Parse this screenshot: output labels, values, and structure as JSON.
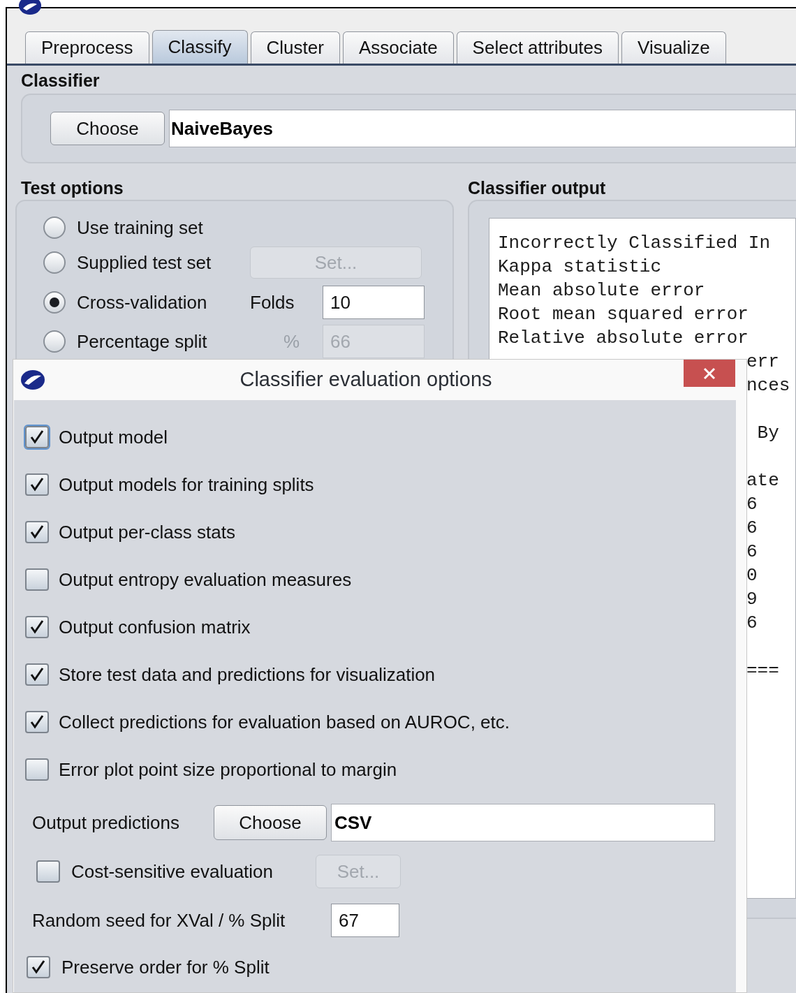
{
  "tabs": [
    {
      "label": "Preprocess",
      "selected": false
    },
    {
      "label": "Classify",
      "selected": true
    },
    {
      "label": "Cluster",
      "selected": false
    },
    {
      "label": "Associate",
      "selected": false
    },
    {
      "label": "Select attributes",
      "selected": false
    },
    {
      "label": "Visualize",
      "selected": false
    }
  ],
  "classifier": {
    "heading": "Classifier",
    "button": "Choose",
    "value": "NaiveBayes"
  },
  "test_options": {
    "heading": "Test options",
    "options": [
      {
        "kind": "plain",
        "label": "Use training set",
        "selected": false
      },
      {
        "kind": "button",
        "label": "Supplied test set",
        "selected": false,
        "button": "Set...",
        "disabled": true
      },
      {
        "kind": "field",
        "label": "Cross-validation",
        "selected": true,
        "field_label": "Folds",
        "value": "10",
        "disabled": false
      },
      {
        "kind": "field",
        "label": "Percentage split",
        "selected": false,
        "field_label": "%",
        "value": "66",
        "disabled": true
      }
    ]
  },
  "classifier_output": {
    "heading": "Classifier output",
    "rows": [
      {
        "kind": "line",
        "text": "Incorrectly Classified In"
      },
      {
        "kind": "line",
        "text": "Kappa statistic"
      },
      {
        "kind": "line",
        "text": "Mean absolute error"
      },
      {
        "kind": "line",
        "text": "Root mean squared error"
      },
      {
        "kind": "line",
        "text": "Relative absolute error"
      },
      {
        "kind": "tail",
        "text": "err"
      },
      {
        "kind": "tail",
        "text": "nces"
      },
      {
        "kind": "blank"
      },
      {
        "kind": "tail",
        "text": " By"
      },
      {
        "kind": "blank"
      },
      {
        "kind": "tail",
        "text": "ate"
      },
      {
        "kind": "tail",
        "text": "6"
      },
      {
        "kind": "tail",
        "text": "6"
      },
      {
        "kind": "tail",
        "text": "6"
      },
      {
        "kind": "tail",
        "text": "0"
      },
      {
        "kind": "tail",
        "text": "9"
      },
      {
        "kind": "tail",
        "text": "6"
      },
      {
        "kind": "blank"
      },
      {
        "kind": "tail",
        "text": "==="
      }
    ]
  },
  "dialog": {
    "title": "Classifier evaluation options",
    "checkboxes": [
      {
        "label": "Output model",
        "checked": true,
        "focused": true
      },
      {
        "label": "Output models for training splits",
        "checked": true,
        "focused": false
      },
      {
        "label": "Output per-class stats",
        "checked": true,
        "focused": false
      },
      {
        "label": "Output entropy evaluation measures",
        "checked": false,
        "focused": false
      },
      {
        "label": "Output confusion matrix",
        "checked": true,
        "focused": false
      },
      {
        "label": "Store test data and predictions for visualization",
        "checked": true,
        "focused": false
      },
      {
        "label": "Collect predictions for evaluation based on AUROC, etc.",
        "checked": true,
        "focused": false
      },
      {
        "label": "Error plot point size proportional to margin",
        "checked": false,
        "focused": false
      }
    ],
    "output_predictions": {
      "label": "Output predictions",
      "button": "Choose",
      "value": "CSV"
    },
    "cost_sensitive": {
      "label": "Cost-sensitive evaluation",
      "checked": false,
      "button": "Set...",
      "disabled": true
    },
    "random_seed": {
      "label": "Random seed for XVal / % Split",
      "value": "67"
    },
    "preserve_order": {
      "label": "Preserve order for % Split",
      "checked": true
    }
  }
}
